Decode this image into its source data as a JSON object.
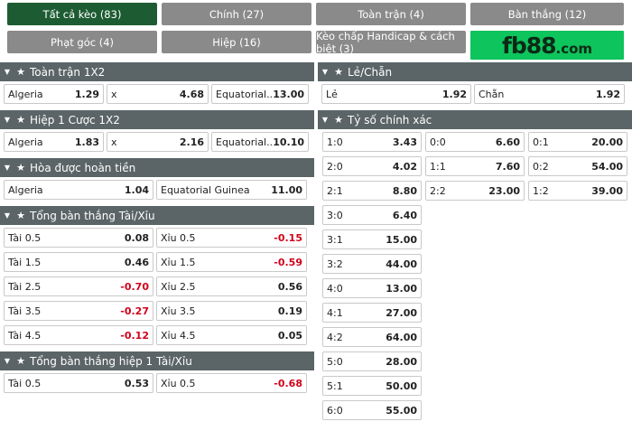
{
  "tabs": [
    {
      "label": "Tất cả kèo (83)",
      "active": true
    },
    {
      "label": "Chính (27)"
    },
    {
      "label": "Toàn trận (4)"
    },
    {
      "label": "Bàn thắng (12)"
    },
    {
      "label": "Phạt góc (4)"
    },
    {
      "label": "Hiệp (16)"
    },
    {
      "label": "Kèo chấp Handicap & cách biệt (3)"
    }
  ],
  "logo": {
    "main": "fb88",
    "suffix": ".com"
  },
  "left_sections": [
    {
      "title": "Toàn trận 1X2",
      "rows": [
        [
          [
            "Algeria",
            "1.29"
          ],
          [
            "x",
            "4.68"
          ],
          [
            "Equatorial...",
            "13.00"
          ]
        ]
      ]
    },
    {
      "title": "Hiệp 1 Cược 1X2",
      "rows": [
        [
          [
            "Algeria",
            "1.83"
          ],
          [
            "x",
            "2.16"
          ],
          [
            "Equatorial...",
            "10.10"
          ]
        ]
      ]
    },
    {
      "title": "Hòa được hoàn tiền",
      "rows": [
        [
          [
            "Algeria",
            "1.04"
          ],
          [
            "Equatorial Guinea",
            "11.00"
          ]
        ]
      ]
    },
    {
      "title": "Tổng bàn thắng Tài/Xỉu",
      "rows": [
        [
          [
            "Tài 0.5",
            "0.08"
          ],
          [
            "Xỉu 0.5",
            "-0.15"
          ]
        ],
        [
          [
            "Tài 1.5",
            "0.46"
          ],
          [
            "Xỉu 1.5",
            "-0.59"
          ]
        ],
        [
          [
            "Tài 2.5",
            "-0.70"
          ],
          [
            "Xỉu 2.5",
            "0.56"
          ]
        ],
        [
          [
            "Tài 3.5",
            "-0.27"
          ],
          [
            "Xỉu 3.5",
            "0.19"
          ]
        ],
        [
          [
            "Tài 4.5",
            "-0.12"
          ],
          [
            "Xỉu 4.5",
            "0.05"
          ]
        ]
      ]
    },
    {
      "title": "Tổng bàn thắng hiệp 1 Tài/Xỉu",
      "rows": [
        [
          [
            "Tài 0.5",
            "0.53"
          ],
          [
            "Xỉu 0.5",
            "-0.68"
          ]
        ]
      ]
    }
  ],
  "right_sections": [
    {
      "title": "Lẻ/Chẵn",
      "rows": [
        [
          [
            "Lẻ",
            "1.92"
          ],
          [
            "Chẵn",
            "1.92"
          ]
        ]
      ]
    },
    {
      "title": "Tỷ số chính xác"
    }
  ],
  "correct_score": {
    "col1": [
      [
        "1:0",
        "3.43"
      ],
      [
        "2:0",
        "4.02"
      ],
      [
        "2:1",
        "8.80"
      ],
      [
        "3:0",
        "6.40"
      ],
      [
        "3:1",
        "15.00"
      ],
      [
        "3:2",
        "44.00"
      ],
      [
        "4:0",
        "13.00"
      ],
      [
        "4:1",
        "27.00"
      ],
      [
        "4:2",
        "64.00"
      ],
      [
        "5:0",
        "28.00"
      ],
      [
        "5:1",
        "50.00"
      ],
      [
        "6:0",
        "55.00"
      ]
    ],
    "col2": [
      [
        "0:0",
        "6.60"
      ],
      [
        "1:1",
        "7.60"
      ],
      [
        "2:2",
        "23.00"
      ]
    ],
    "col3": [
      [
        "0:1",
        "20.00"
      ],
      [
        "0:2",
        "54.00"
      ],
      [
        "1:2",
        "39.00"
      ]
    ]
  },
  "colors": {
    "active_tab": "#1d5c33",
    "tab": "#8a8a8a",
    "header": "#5b6466",
    "negative": "#d0021b",
    "logo_bg": "#0ec45c"
  },
  "icons": {
    "collapse": "caret-down-icon",
    "favorite": "star-icon"
  }
}
